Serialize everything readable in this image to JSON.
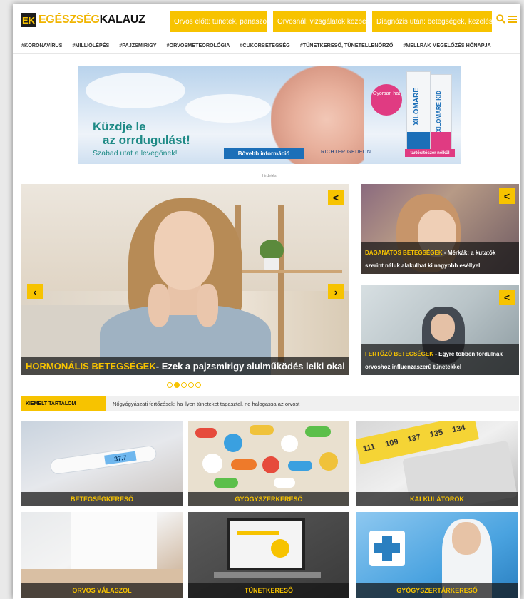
{
  "header": {
    "logo": {
      "part1": "EGÉSZSÉG",
      "part2": "KALAUZ",
      "mark": "EK"
    },
    "nav": [
      {
        "label": "Orvos előtt: tünetek, panaszok"
      },
      {
        "label": "Orvosnál: vizsgálatok közben"
      },
      {
        "label": "Diagnózis után: betegségek, kezelések"
      }
    ],
    "caret": "▼",
    "icons": {
      "search": "search-icon",
      "menu": "menu-icon"
    }
  },
  "tags": [
    "#KORONAVÍRUS",
    "#MILLIÓLÉPÉS",
    "#PAJZSMIRIGY",
    "#ORVOSMETEOROLÓGIA",
    "#CUKORBETEGSÉG",
    "#TÜNETKERESŐ, TÜNETELLENŐRZŐ",
    "#MELLRÁK MEGELŐZÉS HÓNAPJA"
  ],
  "ad": {
    "title_line1": "Küzdje le",
    "title_line2": "az orrdugulást!",
    "subtitle": "Szabad utat a levegőnek!",
    "button": "Bővebb információ",
    "brand": "RICHTER GEDEON",
    "badge": "Gyorsan hat",
    "product1": "XILOMARE",
    "product2": "XILOMARE KID",
    "pill": "tartósítószer nélkül",
    "note": "hirdetés"
  },
  "hero": {
    "category": "HORMONÁLIS BETEGSÉGEK",
    "title": " - Ezek a pajzsmirigy alulműködés lelki okai",
    "prev": "‹",
    "next": "›"
  },
  "side": [
    {
      "category": "DAGANATOS BETEGSÉGEK",
      "title": " - Mérkák: a kutatók szerint náluk alakulhat ki nagyobb eséllyel"
    },
    {
      "category": "FERTŐZŐ BETEGSÉGEK",
      "title": " - Egyre többen fordulnak orvoshoz influenzaszerű tünetekkel"
    }
  ],
  "share_glyph": "<",
  "carousel": {
    "count": 5,
    "active": 1
  },
  "featured": {
    "label": "KIEMELT TARTALOM",
    "text": "Nőgyógyászati fertőzések: ha ilyen tüneteket tapasztal, ne halogassa az orvost"
  },
  "tiles": [
    {
      "label": "BETEGSÉGKERESŐ"
    },
    {
      "label": "GYÓGYSZERKERESŐ"
    },
    {
      "label": "KALKULÁTOROK"
    },
    {
      "label": "ORVOS VÁLASZOL"
    },
    {
      "label": "TÜNETKERESŐ"
    },
    {
      "label": "GYÓGYSZERTÁRKERESŐ"
    }
  ],
  "tile_extras": {
    "thermometer": "37.7",
    "tape": [
      "111",
      "109",
      "137",
      "135",
      "134"
    ]
  },
  "colors": {
    "accent": "#f7c300",
    "caption_bg": "#141414"
  }
}
